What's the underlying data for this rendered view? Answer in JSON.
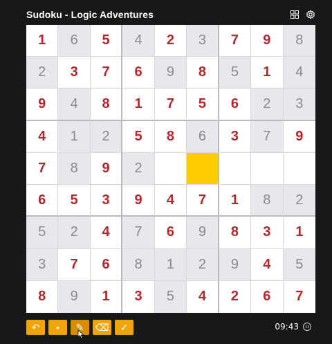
{
  "app": {
    "title": "Sudoku - Logic Adventures",
    "accent_color": "#f0a30a",
    "given_color": "#8a8a8a",
    "entered_color": "#b5262d",
    "selected_color": "#ffcc00"
  },
  "header": {
    "icons": [
      "grid-menu-icon",
      "settings-gear-icon"
    ]
  },
  "board": {
    "rows": [
      [
        [
          "1",
          "e"
        ],
        [
          "6",
          "g"
        ],
        [
          "5",
          "e"
        ],
        [
          "4",
          "g"
        ],
        [
          "2",
          "e"
        ],
        [
          "3",
          "g"
        ],
        [
          "7",
          "e"
        ],
        [
          "9",
          "e"
        ],
        [
          "8",
          "g"
        ]
      ],
      [
        [
          "2",
          "g"
        ],
        [
          "3",
          "e"
        ],
        [
          "7",
          "e"
        ],
        [
          "6",
          "e"
        ],
        [
          "9",
          "g"
        ],
        [
          "8",
          "e"
        ],
        [
          "5",
          "g"
        ],
        [
          "1",
          "e"
        ],
        [
          "4",
          "g"
        ]
      ],
      [
        [
          "9",
          "e"
        ],
        [
          "4",
          "g"
        ],
        [
          "8",
          "e"
        ],
        [
          "1",
          "e"
        ],
        [
          "7",
          "e"
        ],
        [
          "5",
          "e"
        ],
        [
          "6",
          "e"
        ],
        [
          "2",
          "g"
        ],
        [
          "3",
          "g"
        ]
      ],
      [
        [
          "4",
          "e"
        ],
        [
          "1",
          "g"
        ],
        [
          "2",
          "g"
        ],
        [
          "5",
          "e"
        ],
        [
          "8",
          "e"
        ],
        [
          "6",
          "g"
        ],
        [
          "3",
          "e"
        ],
        [
          "7",
          "g"
        ],
        [
          "9",
          "e"
        ]
      ],
      [
        [
          "7",
          "e"
        ],
        [
          "8",
          "g"
        ],
        [
          "9",
          "e"
        ],
        [
          "2",
          "g"
        ],
        [
          "",
          "e"
        ],
        [
          "",
          "s"
        ],
        [
          "",
          "e"
        ],
        [
          "",
          "e"
        ],
        [
          "",
          "e"
        ]
      ],
      [
        [
          "6",
          "e"
        ],
        [
          "5",
          "e"
        ],
        [
          "3",
          "e"
        ],
        [
          "9",
          "e"
        ],
        [
          "4",
          "e"
        ],
        [
          "7",
          "e"
        ],
        [
          "1",
          "e"
        ],
        [
          "8",
          "g"
        ],
        [
          "2",
          "g"
        ]
      ],
      [
        [
          "5",
          "g"
        ],
        [
          "2",
          "g"
        ],
        [
          "4",
          "e"
        ],
        [
          "7",
          "g"
        ],
        [
          "6",
          "e"
        ],
        [
          "9",
          "g"
        ],
        [
          "8",
          "e"
        ],
        [
          "3",
          "e"
        ],
        [
          "1",
          "e"
        ]
      ],
      [
        [
          "3",
          "g"
        ],
        [
          "7",
          "e"
        ],
        [
          "6",
          "e"
        ],
        [
          "8",
          "g"
        ],
        [
          "1",
          "g"
        ],
        [
          "2",
          "g"
        ],
        [
          "9",
          "g"
        ],
        [
          "4",
          "e"
        ],
        [
          "5",
          "g"
        ]
      ],
      [
        [
          "8",
          "e"
        ],
        [
          "9",
          "g"
        ],
        [
          "1",
          "e"
        ],
        [
          "3",
          "e"
        ],
        [
          "5",
          "g"
        ],
        [
          "4",
          "e"
        ],
        [
          "2",
          "e"
        ],
        [
          "6",
          "e"
        ],
        [
          "7",
          "e"
        ]
      ]
    ]
  },
  "toolbar": {
    "buttons": [
      {
        "name": "undo-button",
        "icon": "undo-icon",
        "glyph": "↶"
      },
      {
        "name": "notes-button",
        "icon": "notes-icon",
        "glyph": "•"
      },
      {
        "name": "pencil-button",
        "icon": "pencil-icon",
        "glyph": "✎"
      },
      {
        "name": "erase-button",
        "icon": "eraser-icon",
        "glyph": "⌫"
      },
      {
        "name": "check-button",
        "icon": "check-icon",
        "glyph": "✓"
      }
    ]
  },
  "status": {
    "timer": "09:43",
    "pause_icon": "pause-icon"
  }
}
